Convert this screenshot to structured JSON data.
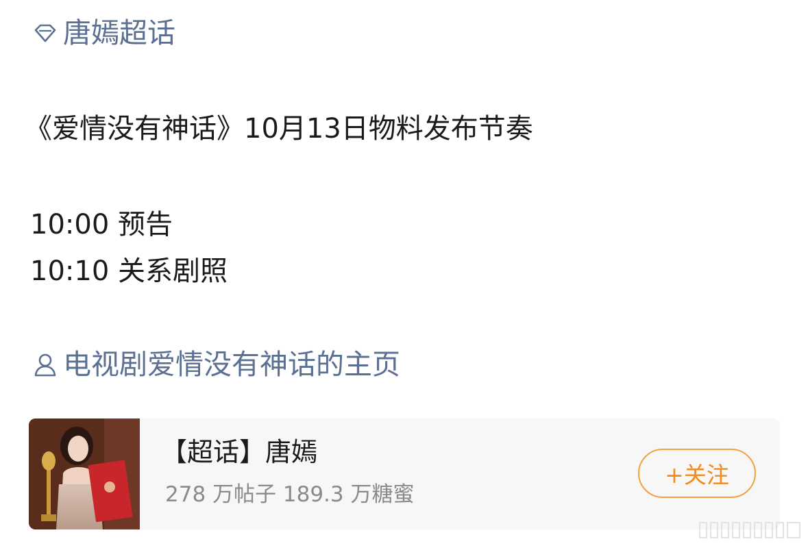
{
  "topic_link": {
    "icon": "diamond-icon",
    "label": "唐嫣超话"
  },
  "post": {
    "title_line": "《爱情没有神话》10月13日物料发布节奏",
    "schedule": [
      "10:00 预告",
      "10:10 关系剧照"
    ]
  },
  "homepage_link": {
    "icon": "user-icon",
    "label": "电视剧爱情没有神话的主页"
  },
  "supertopic_card": {
    "title": "【超话】唐嫣",
    "stats": "278 万帖子 189.3 万糖蜜",
    "follow_label": "+关注"
  },
  "colors": {
    "link": "#5a6f92",
    "follow_accent": "#f2a23c",
    "card_bg": "#f7f7f7",
    "stats_text": "#8a8a8a"
  }
}
